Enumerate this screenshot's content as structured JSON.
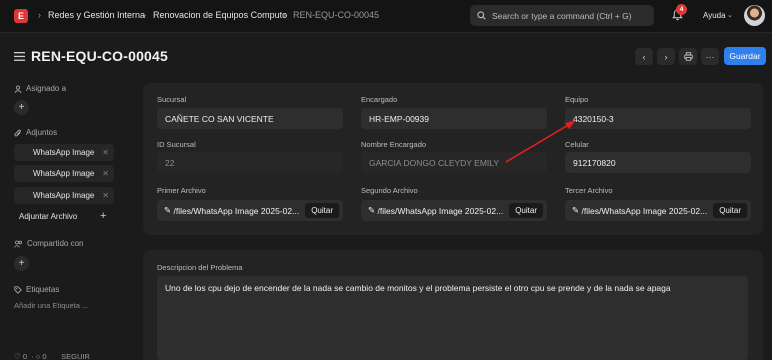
{
  "navbar": {
    "logo_letter": "E",
    "breadcrumbs": [
      "Redes y Gestión Interna",
      "Renovacion de Equipos Computo",
      "REN-EQU-CO-00045"
    ],
    "search_placeholder": "Search or type a command (Ctrl + G)",
    "notification_count": "4",
    "help_label": "Ayuda"
  },
  "page": {
    "title": "REN-EQU-CO-00045",
    "save_label": "Guardar"
  },
  "sidebar": {
    "assigned_label": "Asignado a",
    "attachments_label": "Adjuntos",
    "attachments": [
      "WhatsApp Image",
      "WhatsApp Image",
      "WhatsApp Image"
    ],
    "add_attachment_label": "Adjuntar Archivo",
    "shared_label": "Compartido con",
    "tags_label": "Etiquetas",
    "add_tag_label": "Añadir una Etiqueta ...",
    "likes": "0",
    "comments": "0",
    "follow_label": "SEGUIR"
  },
  "form": {
    "sucursal": {
      "label": "Sucursal",
      "value": "CAÑETE CO SAN VICENTE"
    },
    "encargado": {
      "label": "Encargado",
      "value": "HR-EMP-00939"
    },
    "equipo": {
      "label": "Equipo",
      "value": "4320150-3"
    },
    "id_sucursal": {
      "label": "ID Sucursal",
      "value": "22"
    },
    "nombre_encargado": {
      "label": "Nombre Encargado",
      "value": "GARCIA DONGO CLEYDY EMILY"
    },
    "celular": {
      "label": "Celular",
      "value": "912170820"
    },
    "primer_archivo": {
      "label": "Primer Archivo",
      "value": "/files/WhatsApp Image 2025-02..."
    },
    "segundo_archivo": {
      "label": "Segundo Archivo",
      "value": "/files/WhatsApp Image 2025-02..."
    },
    "tercer_archivo": {
      "label": "Tercer Archivo",
      "value": "/files/WhatsApp Image 2025-02..."
    },
    "remove_label": "Quitar",
    "descripcion": {
      "label": "Descripcion del Problema",
      "value": "Uno de los cpu  dejo de encender de la nada se cambio de monitos y el problema persiste el otro cpu se prende y de la nada se apaga"
    }
  },
  "colors": {
    "accent": "#2f80ed",
    "brand": "#e03636",
    "annotation_arrow": "#e0201c"
  }
}
